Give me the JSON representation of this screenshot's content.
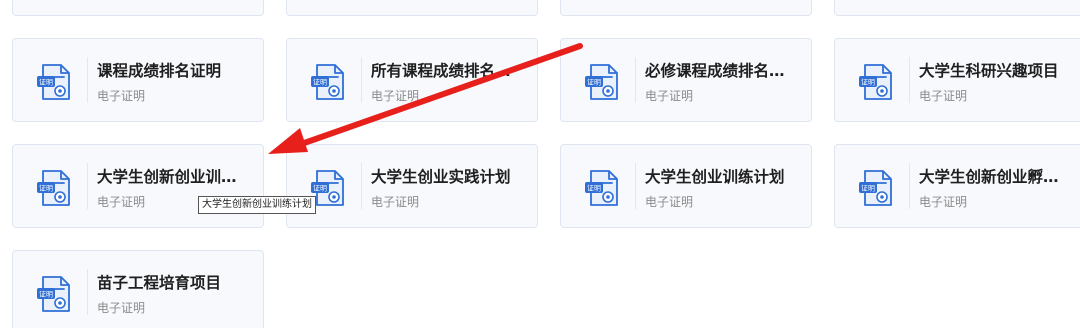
{
  "cards": [
    {
      "title": "课程成绩排名证明",
      "subtitle": "电子证明"
    },
    {
      "title": "所有课程成绩排名…",
      "subtitle": "电子证明"
    },
    {
      "title": "必修课程成绩排名…",
      "subtitle": "电子证明"
    },
    {
      "title": "大学生科研兴趣项目",
      "subtitle": "电子证明"
    },
    {
      "title": "大学生创新创业训…",
      "subtitle": "电子证明"
    },
    {
      "title": "大学生创业实践计划",
      "subtitle": "电子证明"
    },
    {
      "title": "大学生创业训练计划",
      "subtitle": "电子证明"
    },
    {
      "title": "大学生创新创业孵…",
      "subtitle": "电子证明"
    },
    {
      "title": "苗子工程培育项目",
      "subtitle": "电子证明"
    }
  ],
  "icon": {
    "badge_text": "证明",
    "name": "certificate-document-icon",
    "accent": "#2f6fd6"
  },
  "tooltip": "大学生创新创业训练计划",
  "annotation": {
    "color": "#e8201c"
  }
}
